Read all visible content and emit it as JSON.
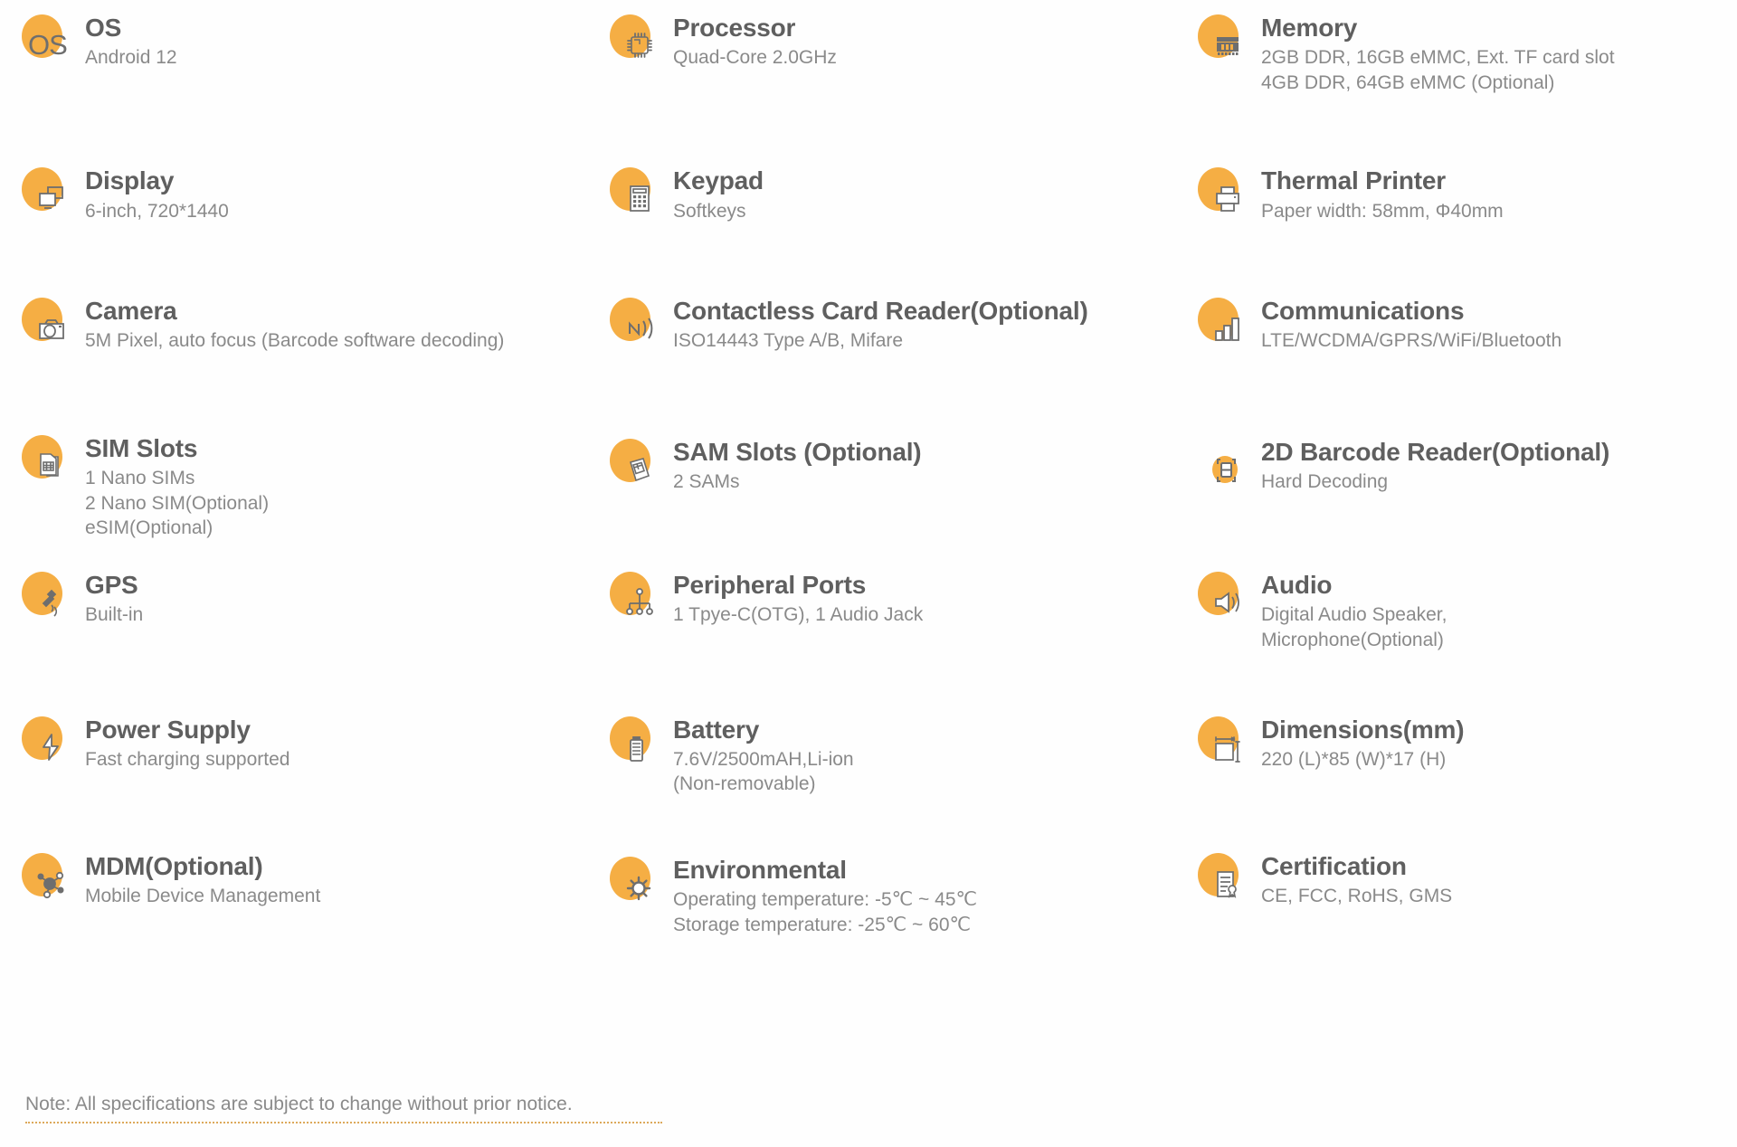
{
  "theme": {
    "accent": "#F5AE44",
    "title_color": "#5f5f5f",
    "desc_color": "#8a8a8a",
    "background": "#fefefe",
    "note_rule_color": "#d79b3e"
  },
  "specs": [
    {
      "icon": "os-text-icon",
      "title": "OS",
      "desc": "Android 12"
    },
    {
      "icon": "processor-chip-icon",
      "title": "Processor",
      "desc": "Quad-Core 2.0GHz"
    },
    {
      "icon": "memory-chip-icon",
      "title": "Memory",
      "desc": "2GB DDR, 16GB eMMC, Ext. TF card slot\n4GB DDR, 64GB eMMC (Optional)"
    },
    {
      "icon": "display-monitor-icon",
      "title": "Display",
      "desc": "6-inch, 720*1440"
    },
    {
      "icon": "keypad-icon",
      "title": "Keypad",
      "desc": "Softkeys"
    },
    {
      "icon": "thermal-printer-icon",
      "title": "Thermal Printer",
      "desc": "Paper width: 58mm, Φ40mm"
    },
    {
      "icon": "camera-icon",
      "title": "Camera",
      "desc": "5M Pixel, auto focus (Barcode software decoding)"
    },
    {
      "icon": "nfc-wave-icon",
      "title": "Contactless Card Reader(Optional)",
      "desc": "ISO14443 Type A/B, Mifare"
    },
    {
      "icon": "signal-bars-icon",
      "title": "Communications",
      "desc": "LTE/WCDMA/GPRS/WiFi/Bluetooth"
    },
    {
      "icon": "sim-card-stack-icon",
      "title": "SIM Slots",
      "desc": "1 Nano SIMs\n2 Nano SIM(Optional)\neSIM(Optional)"
    },
    {
      "icon": "sam-card-icon",
      "title": "SAM Slots (Optional)",
      "desc": "2 SAMs"
    },
    {
      "icon": "barcode-scan-icon",
      "title": "2D Barcode Reader(Optional)",
      "desc": "Hard Decoding"
    },
    {
      "icon": "gps-satellite-icon",
      "title": "GPS",
      "desc": "Built-in"
    },
    {
      "icon": "peripheral-ports-icon",
      "title": "Peripheral Ports",
      "desc": "1 Tpye-C(OTG), 1 Audio Jack"
    },
    {
      "icon": "audio-speaker-icon",
      "title": "Audio",
      "desc": "Digital Audio Speaker,\nMicrophone(Optional)"
    },
    {
      "icon": "power-bolt-icon",
      "title": "Power Supply",
      "desc": "Fast charging supported"
    },
    {
      "icon": "battery-icon",
      "title": "Battery",
      "desc": "7.6V/2500mAH,Li-ion\n(Non-removable)"
    },
    {
      "icon": "dimensions-icon",
      "title": "Dimensions(mm)",
      "desc": "220 (L)*85 (W)*17 (H)"
    },
    {
      "icon": "mdm-network-icon",
      "title": "MDM(Optional)",
      "desc": "Mobile Device Management"
    },
    {
      "icon": "environmental-sun-icon",
      "title": "Environmental",
      "desc": "Operating temperature: -5℃ ~ 45℃\nStorage temperature: -25℃ ~ 60℃"
    },
    {
      "icon": "certification-icon",
      "title": "Certification",
      "desc": "CE, FCC, RoHS, GMS"
    }
  ],
  "footer": {
    "note": "Note: All specifications are subject to change without prior notice."
  }
}
